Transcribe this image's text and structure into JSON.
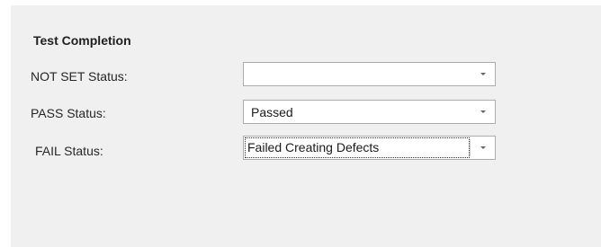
{
  "section": {
    "title": "Test Completion"
  },
  "fields": [
    {
      "label": "NOT SET Status:",
      "value": ""
    },
    {
      "label": "PASS Status:",
      "value": "Passed"
    },
    {
      "label": "FAIL Status:",
      "value": "Failed Creating Defects"
    }
  ],
  "icons": {
    "dropdown": "chevron-down-icon"
  }
}
